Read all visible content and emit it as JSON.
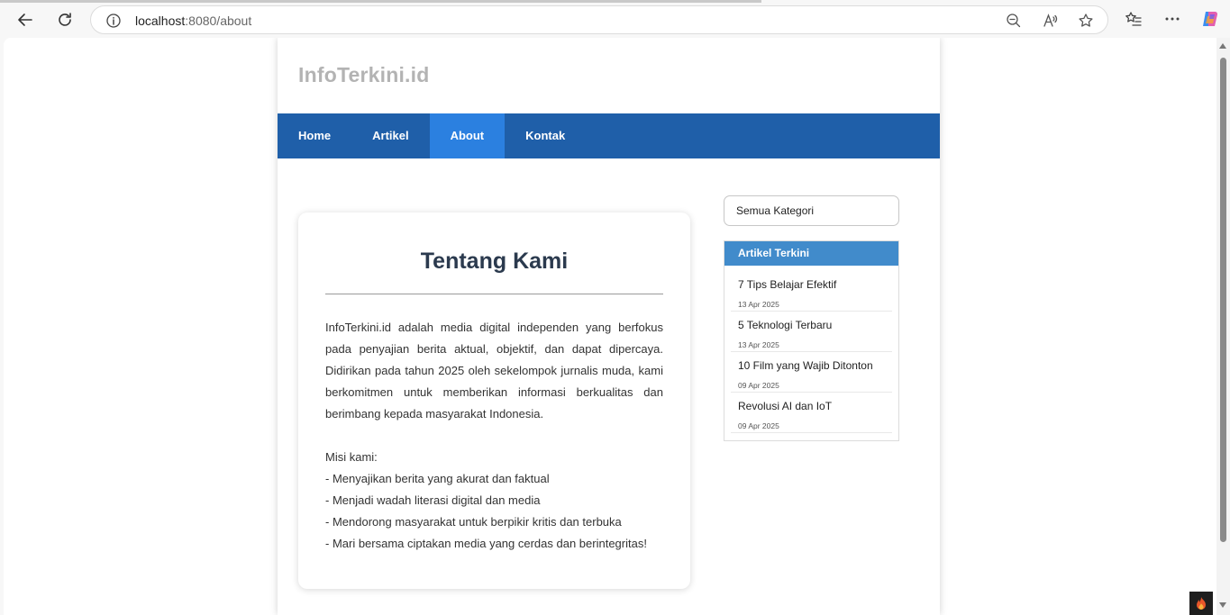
{
  "browser": {
    "url_host": "localhost",
    "url_path": ":8080/about"
  },
  "site": {
    "logo": "InfoTerkini.id",
    "nav": [
      "Home",
      "Artikel",
      "About",
      "Kontak"
    ],
    "active_nav": "About"
  },
  "about": {
    "title": "Tentang Kami",
    "paragraph": "InfoTerkini.id adalah media digital independen yang berfokus pada penyajian berita aktual, objektif, dan dapat dipercaya. Didirikan pada tahun 2025 oleh sekelompok jurnalis muda, kami berkomitmen untuk memberikan informasi berkualitas dan berimbang kepada masyarakat Indonesia.",
    "mission_label": "Misi kami:",
    "missions": [
      "- Menyajikan berita yang akurat dan faktual",
      "- Menjadi wadah literasi digital dan media",
      "- Mendorong masyarakat untuk berpikir kritis dan terbuka",
      "- Mari bersama ciptakan media yang cerdas dan berintegritas!"
    ]
  },
  "sidebar": {
    "category_select": "Semua Kategori",
    "widget_title": "Artikel Terkini",
    "articles": [
      {
        "title": "7 Tips Belajar Efektif",
        "date": "13 Apr 2025"
      },
      {
        "title": "5 Teknologi Terbaru",
        "date": "13 Apr 2025"
      },
      {
        "title": "10 Film yang Wajib Ditonton",
        "date": "09 Apr 2025"
      },
      {
        "title": "Revolusi AI dan IoT",
        "date": "09 Apr 2025"
      }
    ]
  },
  "colors": {
    "nav_bg": "#1f5fa9",
    "nav_active": "#2b80e0",
    "widget_header": "#418bcb",
    "title_text": "#2b3a4e"
  }
}
